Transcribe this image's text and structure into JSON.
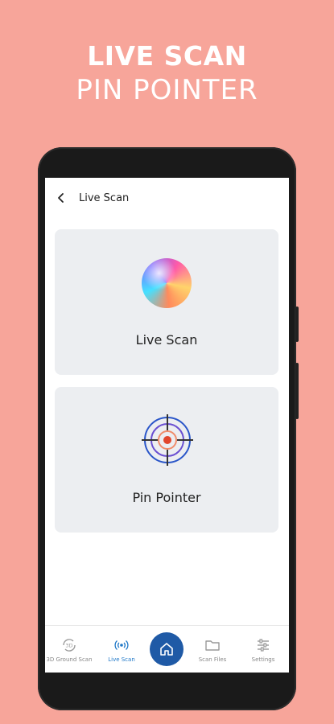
{
  "promo": {
    "title": "LIVE SCAN",
    "subtitle": "PIN POINTER"
  },
  "header": {
    "title": "Live Scan",
    "back_icon": "back-arrow-icon"
  },
  "cards": [
    {
      "label": "Live Scan",
      "icon": "gradient-orb-icon"
    },
    {
      "label": "Pin Pointer",
      "icon": "target-crosshair-icon"
    }
  ],
  "bottom_nav": {
    "items": [
      {
        "label": "3D Ground Scan",
        "icon": "3d-rotate-icon"
      },
      {
        "label": "Live Scan",
        "icon": "signal-waves-icon",
        "active": true
      },
      {
        "label": "Home",
        "icon": "home-icon"
      },
      {
        "label": "Scan Files",
        "icon": "folder-icon"
      },
      {
        "label": "Settings",
        "icon": "sliders-icon"
      }
    ]
  },
  "colors": {
    "background": "#F7A59A",
    "accent": "#1F5AA6",
    "active_nav": "#1F78C8",
    "card_bg": "#ECEEF1"
  }
}
